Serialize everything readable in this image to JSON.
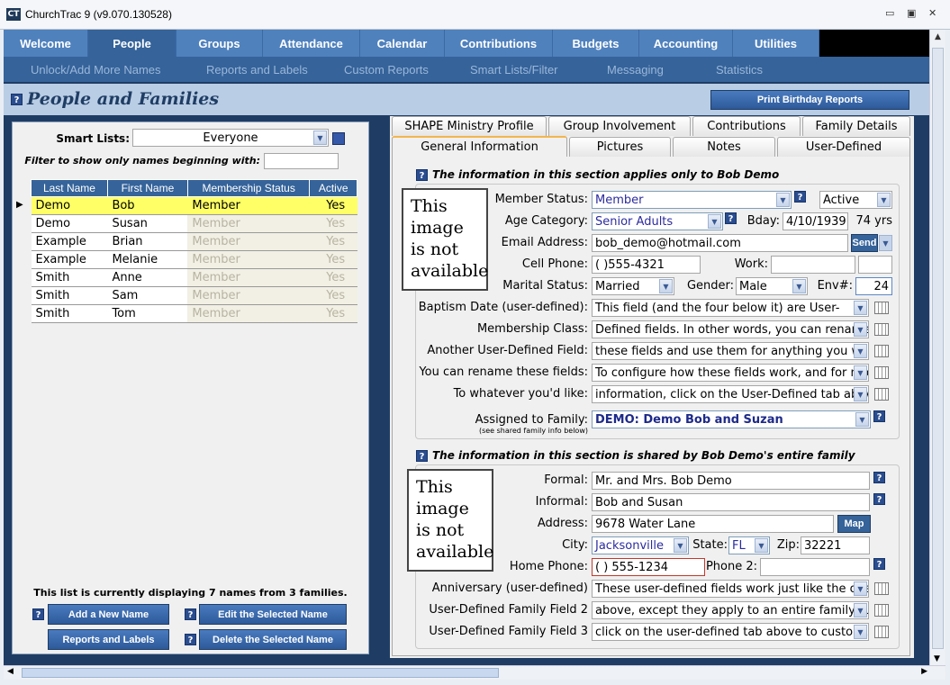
{
  "window": {
    "title": "ChurchTrac 9 (v9.070.130528)",
    "logo": "CT"
  },
  "main_tabs": [
    {
      "label": "Welcome"
    },
    {
      "label": "People",
      "active": true
    },
    {
      "label": "Groups"
    },
    {
      "label": "Attendance"
    },
    {
      "label": "Calendar"
    },
    {
      "label": "Contributions"
    },
    {
      "label": "Budgets"
    },
    {
      "label": "Accounting"
    },
    {
      "label": "Utilities"
    }
  ],
  "sub_nav": [
    "Unlock/Add More Names",
    "Reports and Labels",
    "Custom Reports",
    "Smart Lists/Filter",
    "Messaging",
    "Statistics"
  ],
  "header": {
    "title": "People and Families",
    "print_button": "Print Birthday Reports"
  },
  "left": {
    "smart_lists_label": "Smart Lists:",
    "smart_list_value": "Everyone",
    "filter_label": "Filter to show only names beginning with:",
    "filter_value": "",
    "columns": [
      "Last Name",
      "First Name",
      "Membership Status",
      "Active"
    ],
    "rows": [
      [
        "Demo",
        "Bob",
        "Member",
        "Yes"
      ],
      [
        "Demo",
        "Susan",
        "Member",
        "Yes"
      ],
      [
        "Example",
        "Brian",
        "Member",
        "Yes"
      ],
      [
        "Example",
        "Melanie",
        "Member",
        "Yes"
      ],
      [
        "Smith",
        "Anne",
        "Member",
        "Yes"
      ],
      [
        "Smith",
        "Sam",
        "Member",
        "Yes"
      ],
      [
        "Smith",
        "Tom",
        "Member",
        "Yes"
      ]
    ],
    "status": "This list is currently displaying 7 names from 3 families.",
    "buttons": {
      "add": "Add a New Name",
      "edit": "Edit the Selected Name",
      "reports": "Reports and Labels",
      "delete": "Delete the Selected Name"
    }
  },
  "right": {
    "tabs_row1": [
      "SHAPE Ministry Profile",
      "Group Involvement",
      "Contributions",
      "Family Details"
    ],
    "tabs_row2": [
      "General Information",
      "Pictures",
      "Notes",
      "User-Defined"
    ],
    "image_placeholder": "This image is not available",
    "person_section": "The information in this section applies only to Bob Demo",
    "member_status_label": "Member Status:",
    "member_status": "Member",
    "active_value": "Active",
    "age_category_label": "Age Category:",
    "age_category": "Senior Adults",
    "bday_label": "Bday:",
    "bday": "4/10/1939",
    "age": "74 yrs",
    "email_label": "Email Address:",
    "email": "bob_demo@hotmail.com",
    "send": "Send",
    "cell_label": "Cell Phone:",
    "cell": "(   )555-4321",
    "work_label": "Work:",
    "work": "",
    "work_ext": "",
    "marital_label": "Marital Status:",
    "marital": "Married",
    "gender_label": "Gender:",
    "gender": "Male",
    "env_label": "Env#:",
    "env": "24",
    "user_fields": [
      {
        "label": "Baptism Date (user-defined):",
        "value": "This field (and the four below it) are User-"
      },
      {
        "label": "Membership Class:",
        "value": "Defined fields. In other words, you can rename"
      },
      {
        "label": "Another User-Defined Field:",
        "value": "these fields and use them for anything you want"
      },
      {
        "label": "You can rename these fields:",
        "value": "To configure how these fields work, and for more"
      },
      {
        "label": "To whatever you'd like:",
        "value": "information, click on the User-Defined tab above"
      }
    ],
    "assigned_label": "Assigned to Family:",
    "assigned_note": "(see shared family info below)",
    "assigned": "DEMO: Demo Bob and Suzan",
    "family_section": "The information in this section is shared by Bob Demo's entire family",
    "formal_label": "Formal:",
    "formal": "Mr. and Mrs. Bob Demo",
    "informal_label": "Informal:",
    "informal": "Bob and Susan",
    "address_label": "Address:",
    "address": "9678 Water Lane",
    "map": "Map",
    "city_label": "City:",
    "city": "Jacksonville",
    "state_label": "State:",
    "state": "FL",
    "zip_label": "Zip:",
    "zip": "32221",
    "home_label": "Home Phone:",
    "home": "(   ) 555-1234",
    "phone2_label": "Phone 2:",
    "phone2": "",
    "family_fields": [
      {
        "label": "Anniversary (user-defined)",
        "value": "These user-defined fields work just like the ones"
      },
      {
        "label": "User-Defined Family Field 2",
        "value": "above, except they apply to an entire family. Just"
      },
      {
        "label": "User-Defined Family Field 3",
        "value": "click on the user-defined tab above to customize"
      }
    ]
  },
  "colors": {
    "tab": "#4f81bd",
    "tab_active": "#35639a",
    "navy": "#1f3d64",
    "selected_row": "#ffff66"
  }
}
